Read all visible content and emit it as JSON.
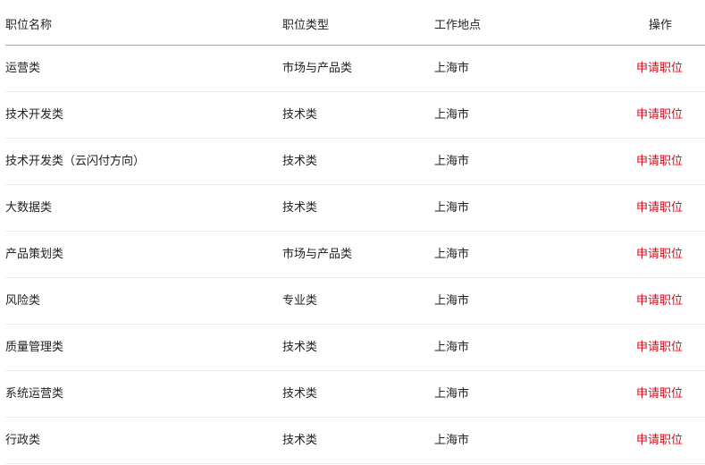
{
  "table": {
    "headers": {
      "name": "职位名称",
      "type": "职位类型",
      "location": "工作地点",
      "action": "操作"
    },
    "accent_color": "#e60012",
    "rows": [
      {
        "name": "运营类",
        "type": "市场与产品类",
        "location": "上海市",
        "action": "申请职位"
      },
      {
        "name": "技术开发类",
        "type": "技术类",
        "location": "上海市",
        "action": "申请职位"
      },
      {
        "name": "技术开发类（云闪付方向）",
        "type": "技术类",
        "location": "上海市",
        "action": "申请职位"
      },
      {
        "name": "大数据类",
        "type": "技术类",
        "location": "上海市",
        "action": "申请职位"
      },
      {
        "name": "产品策划类",
        "type": "市场与产品类",
        "location": "上海市",
        "action": "申请职位"
      },
      {
        "name": "风险类",
        "type": "专业类",
        "location": "上海市",
        "action": "申请职位"
      },
      {
        "name": "质量管理类",
        "type": "技术类",
        "location": "上海市",
        "action": "申请职位"
      },
      {
        "name": "系统运营类",
        "type": "技术类",
        "location": "上海市",
        "action": "申请职位"
      },
      {
        "name": "行政类",
        "type": "技术类",
        "location": "上海市",
        "action": "申请职位"
      }
    ]
  }
}
